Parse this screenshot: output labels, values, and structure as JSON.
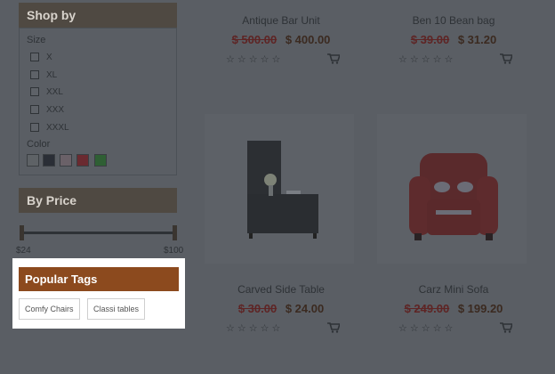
{
  "sidebar": {
    "shop_by_title": "Shop by",
    "size_label": "Size",
    "sizes": [
      "X",
      "XL",
      "XXL",
      "XXX",
      "XXXL"
    ],
    "color_label": "Color",
    "colors": [
      "#5e6266",
      "#2a2e36",
      "#6a6168",
      "#6a2a30",
      "#2f5f34"
    ],
    "price_title": "By Price",
    "price_min": "$24",
    "price_max": "$100"
  },
  "products": [
    {
      "name": "Antique Bar Unit",
      "old_price": "$ 500.00",
      "new_price": "$ 400.00",
      "stars": "☆☆☆☆☆"
    },
    {
      "name": "Ben 10 Bean bag",
      "old_price": "$ 39.00",
      "new_price": "$ 31.20",
      "stars": "☆☆☆☆☆"
    },
    {
      "name": "Carved Side Table",
      "old_price": "$ 30.00",
      "new_price": "$ 24.00",
      "stars": "☆☆☆☆☆"
    },
    {
      "name": "Carz Mini Sofa",
      "old_price": "$ 249.00",
      "new_price": "$ 199.20",
      "stars": "☆☆☆☆☆"
    }
  ],
  "popular_tags": {
    "title": "Popular Tags",
    "tags": [
      "Comfy Chairs",
      "Classi tables"
    ]
  }
}
